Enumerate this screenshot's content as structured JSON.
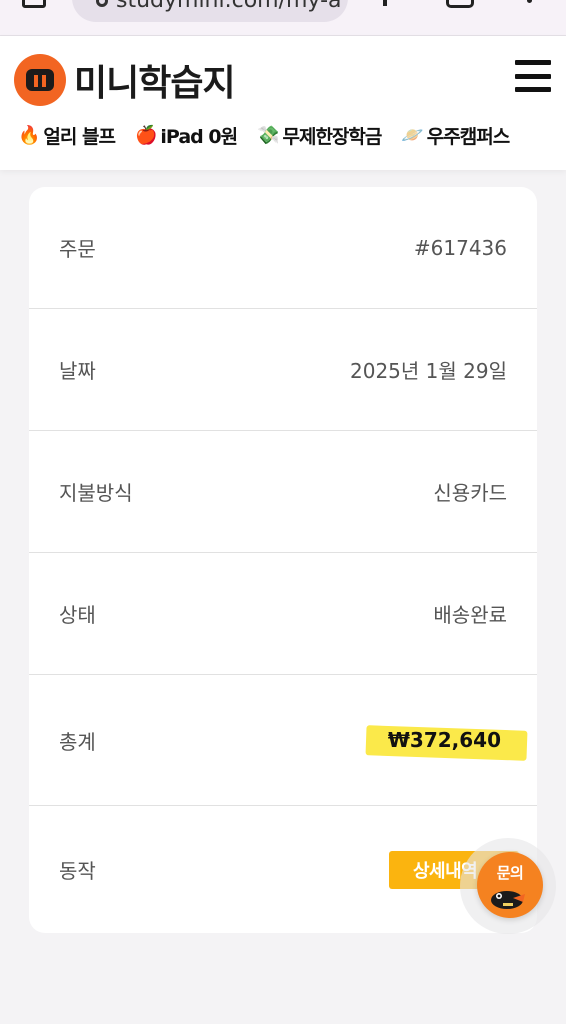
{
  "browser": {
    "url_text": "studymini.com/my-a"
  },
  "site": {
    "logo_text": "미니학습지",
    "brand_color": "#f26522",
    "quick_nav": [
      {
        "icon": "fire-icon",
        "emoji": "🔥",
        "label": "얼리 블프"
      },
      {
        "icon": "apple-icon",
        "emoji": "🍎",
        "label": "iPad 0원"
      },
      {
        "icon": "money-icon",
        "emoji": "💸",
        "label": "무제한장학금"
      },
      {
        "icon": "planet-icon",
        "emoji": "🪐",
        "label": "우주캠퍼스"
      }
    ]
  },
  "order": {
    "rows": [
      {
        "label": "주문",
        "value": "#617436"
      },
      {
        "label": "날짜",
        "value": "2025년 1월 29일"
      },
      {
        "label": "지불방식",
        "value": "신용카드"
      },
      {
        "label": "상태",
        "value": "배송완료"
      },
      {
        "label": "총계",
        "value": "₩372,640"
      },
      {
        "label": "동작",
        "value": ""
      }
    ],
    "detail_button": "상세내역"
  },
  "chat_fab": {
    "label": "문의"
  },
  "colors": {
    "highlight": "#fbe94a",
    "button": "#fbb40f",
    "fab": "#f58220"
  }
}
